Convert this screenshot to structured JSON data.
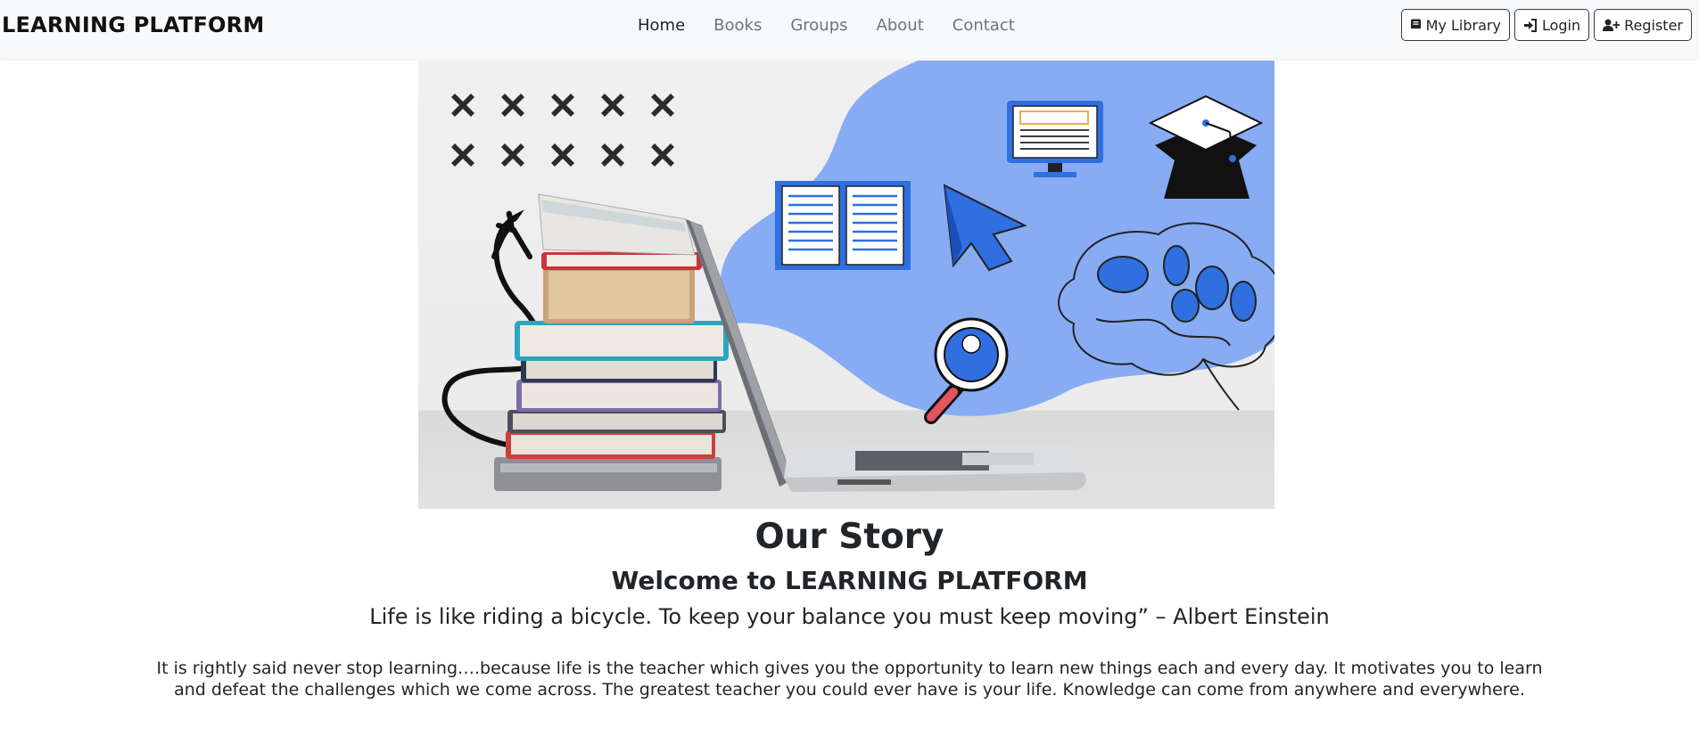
{
  "navbar": {
    "brand": "LEARNING PLATFORM",
    "links": [
      {
        "label": "Home",
        "active": true
      },
      {
        "label": "Books",
        "active": false
      },
      {
        "label": "Groups",
        "active": false
      },
      {
        "label": "About",
        "active": false
      },
      {
        "label": "Contact",
        "active": false
      }
    ],
    "buttons": [
      {
        "label": "My Library",
        "icon": "book-icon"
      },
      {
        "label": "Login",
        "icon": "login-icon"
      },
      {
        "label": "Register",
        "icon": "user-plus-icon"
      }
    ]
  },
  "hero": {
    "image": "books-and-laptop-illustration",
    "accent_color": "#88acf3"
  },
  "content": {
    "title": "Our Story",
    "welcome": "Welcome to LEARNING PLATFORM",
    "quote": "Life is like riding a bicycle. To keep your balance you must keep moving” – Albert Einstein",
    "paragraph": "It is rightly said never stop learning….because life is the teacher which gives you the opportunity to learn new things each and every day. It motivates you to learn and defeat the challenges which we come across. The greatest teacher you could ever have is your life. Knowledge can come from anywhere and everywhere."
  }
}
